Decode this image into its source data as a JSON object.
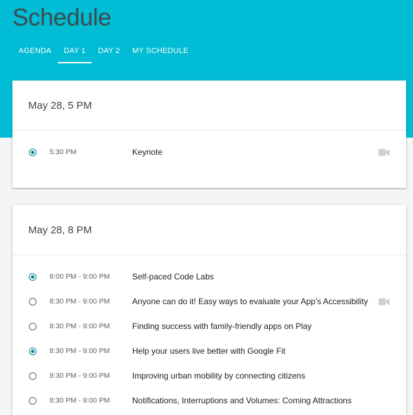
{
  "page": {
    "title": "Schedule"
  },
  "tabs": [
    {
      "label": "AGENDA",
      "active": false
    },
    {
      "label": "DAY 1",
      "active": true
    },
    {
      "label": "DAY 2",
      "active": false
    },
    {
      "label": "MY SCHEDULE",
      "active": false
    }
  ],
  "colors": {
    "header": "#00bcd4",
    "accent": "#00838f",
    "background": "#f5f5f5"
  },
  "blocks": [
    {
      "heading": "May 28, 5 PM",
      "sessions": [
        {
          "time": "5:30 PM",
          "title": "Keynote",
          "selected": true,
          "video_icon": "video-camera-icon"
        }
      ]
    },
    {
      "heading": "May 28, 8 PM",
      "sessions": [
        {
          "time": "8:00 PM - 9:00 PM",
          "title": "Self-paced Code Labs",
          "selected": true
        },
        {
          "time": "8:30 PM - 9:00 PM",
          "title": "Anyone can do it! Easy ways to evaluate your App’s Accessibility",
          "selected": false,
          "video_icon": "video-camera-icon"
        },
        {
          "time": "8:30 PM - 9:00 PM",
          "title": "Finding success with family-friendly apps on Play",
          "selected": false
        },
        {
          "time": "8:30 PM - 9:00 PM",
          "title": "Help your users live better with Google Fit",
          "selected": true
        },
        {
          "time": "8:30 PM - 9:00 PM",
          "title": "Improving urban mobility by connecting citizens",
          "selected": false
        },
        {
          "time": "8:30 PM - 9:00 PM",
          "title": "Notifications, Interruptions and Volumes: Coming Attractions",
          "selected": false
        }
      ]
    }
  ]
}
